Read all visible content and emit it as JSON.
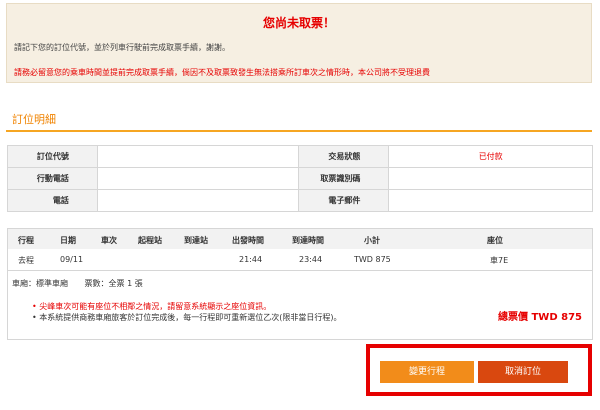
{
  "notice": {
    "title": "您尚未取票！",
    "line1": "請記下您的訂位代號，並於列車行駛前完成取票手續，謝謝。",
    "line2": "請務必留意您的乘車時間並提前完成取票手續，倘因不及取票致發生無法搭乘所訂車次之情形時，本公司將不受理退費"
  },
  "section_title": "訂位明細",
  "info": {
    "rows": [
      {
        "label_left": "訂位代號",
        "value_left": "",
        "label_right": "交易狀態",
        "value_right": "已付款"
      },
      {
        "label_left": "行動電話",
        "value_left": "",
        "label_right": "取票識別碼",
        "value_right": ""
      },
      {
        "label_left": "電話",
        "value_left": "",
        "label_right": "電子郵件",
        "value_right": ""
      }
    ]
  },
  "trip": {
    "headers": [
      "行程",
      "日期",
      "車次",
      "起程站",
      "到達站",
      "出發時間",
      "到達時間",
      "小計",
      "座位"
    ],
    "row": [
      "去程",
      "09/11",
      "",
      "",
      "",
      "21:44",
      "23:44",
      "TWD 875",
      "車7E"
    ],
    "car_class": "車廂：標準車廂",
    "ticket_count": "票數：全票 1 張",
    "notes": [
      "尖峰車次可能有座位不相鄰之情況，請留意系統顯示之座位資訊。",
      "本系統提供商務車廂旅客於訂位完成後，每一行程即可重新選位乙次(限非當日行程)。"
    ],
    "total": "總票價 TWD 875"
  },
  "buttons": {
    "change": "變更行程",
    "cancel": "取消訂位"
  },
  "colors": {
    "accent_orange": "#f08300",
    "alert_red": "#e60000",
    "btn_change": "#f28c1a",
    "btn_cancel": "#d9480f"
  }
}
